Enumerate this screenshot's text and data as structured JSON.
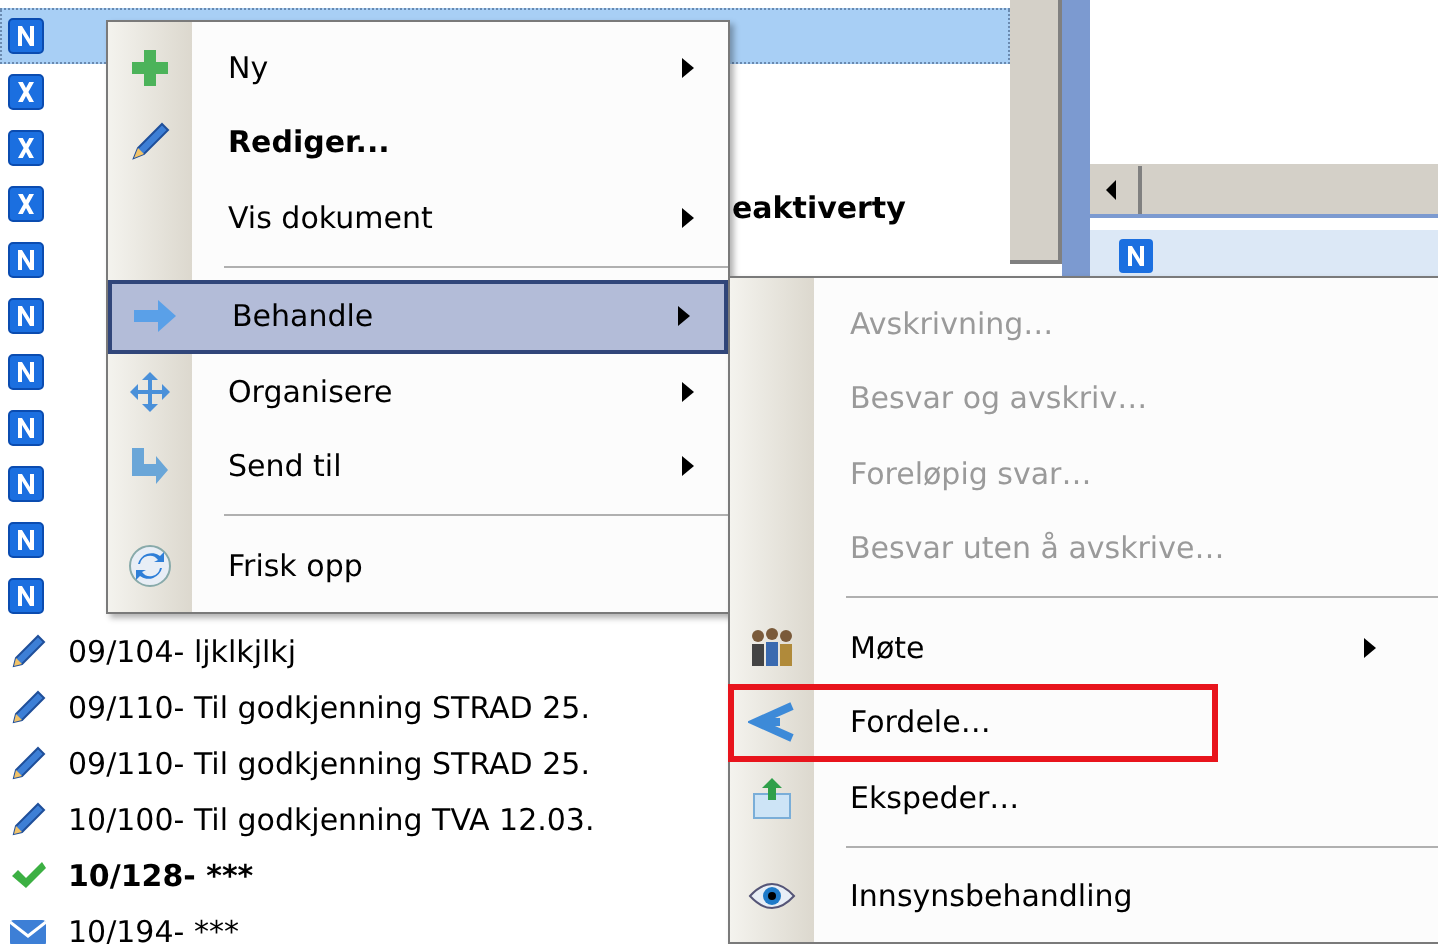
{
  "list": {
    "rows": [
      {
        "kind": "n",
        "selected": true
      },
      {
        "kind": "x",
        "selected": false
      },
      {
        "kind": "x",
        "selected": false
      },
      {
        "kind": "x",
        "selected": false
      },
      {
        "kind": "n",
        "selected": false
      },
      {
        "kind": "n",
        "selected": false
      },
      {
        "kind": "n",
        "selected": false
      },
      {
        "kind": "n",
        "selected": false
      },
      {
        "kind": "n",
        "selected": false
      },
      {
        "kind": "n",
        "selected": false
      },
      {
        "kind": "n",
        "selected": false
      },
      {
        "kind": "pencil",
        "text": "09/104- ljklkjlkj",
        "bold": false,
        "selected": false
      },
      {
        "kind": "pencil",
        "text": "09/110- Til godkjenning STRAD  25.",
        "bold": false,
        "selected": false
      },
      {
        "kind": "pencil",
        "text": "09/110- Til godkjenning STRAD  25.",
        "bold": false,
        "selected": false
      },
      {
        "kind": "pencil",
        "text": "10/100- Til godkjenning TVA  12.03.",
        "bold": false,
        "selected": false
      },
      {
        "kind": "check",
        "text": "10/128- ***",
        "bold": true,
        "selected": false
      },
      {
        "kind": "envelope",
        "text": "10/194- ***",
        "bold": false,
        "selected": false
      }
    ]
  },
  "column_header_fragment": "eaktiverty",
  "context_menu": {
    "items": [
      {
        "kind": "item",
        "label": "Ny",
        "bold": false,
        "has_submenu": true,
        "selected": false
      },
      {
        "kind": "item",
        "label": "Rediger...",
        "bold": true,
        "has_submenu": false,
        "selected": false
      },
      {
        "kind": "item",
        "label": "Vis dokument",
        "bold": false,
        "has_submenu": true,
        "selected": false
      },
      {
        "kind": "separator"
      },
      {
        "kind": "item",
        "label": "Behandle",
        "bold": false,
        "has_submenu": true,
        "selected": true
      },
      {
        "kind": "item",
        "label": "Organisere",
        "bold": false,
        "has_submenu": true,
        "selected": false
      },
      {
        "kind": "item",
        "label": "Send til",
        "bold": false,
        "has_submenu": true,
        "selected": false
      },
      {
        "kind": "separator"
      },
      {
        "kind": "item",
        "label": "Frisk opp",
        "bold": false,
        "has_submenu": false,
        "selected": false
      }
    ]
  },
  "submenu": {
    "items": [
      {
        "kind": "item",
        "label": "Avskrivning…",
        "disabled": true,
        "has_submenu": false,
        "outlined": false
      },
      {
        "kind": "item",
        "label": "Besvar og avskriv…",
        "disabled": true,
        "has_submenu": false,
        "outlined": false
      },
      {
        "kind": "item",
        "label": "Foreløpig svar…",
        "disabled": true,
        "has_submenu": false,
        "outlined": false
      },
      {
        "kind": "item",
        "label": "Besvar uten å avskrive…",
        "disabled": true,
        "has_submenu": false,
        "outlined": false
      },
      {
        "kind": "separator"
      },
      {
        "kind": "item",
        "label": "Møte",
        "disabled": false,
        "has_submenu": true,
        "outlined": false
      },
      {
        "kind": "item",
        "label": "Fordele…",
        "disabled": false,
        "has_submenu": false,
        "outlined": true
      },
      {
        "kind": "item",
        "label": "Ekspeder…",
        "disabled": false,
        "has_submenu": false,
        "outlined": false
      },
      {
        "kind": "separator"
      },
      {
        "kind": "item",
        "label": "Innsynsbehandling",
        "disabled": false,
        "has_submenu": false,
        "outlined": false
      }
    ]
  }
}
